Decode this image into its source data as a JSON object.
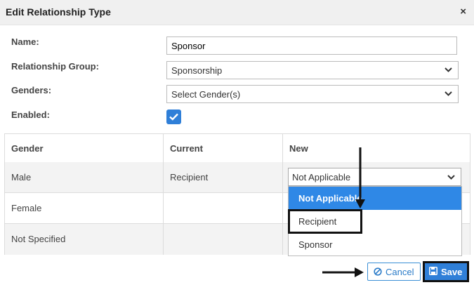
{
  "dialog": {
    "title": "Edit Relationship Type",
    "close_label": "×"
  },
  "form": {
    "name_label": "Name:",
    "name_value": "Sponsor",
    "group_label": "Relationship Group:",
    "group_value": "Sponsorship",
    "genders_label": "Genders:",
    "genders_placeholder": "Select Gender(s)",
    "enabled_label": "Enabled:",
    "enabled_checked": true
  },
  "table": {
    "headers": [
      "Gender",
      "Current",
      "New"
    ],
    "rows": [
      {
        "gender": "Male",
        "current": "Recipient",
        "new": "Not Applicable"
      },
      {
        "gender": "Female",
        "current": "",
        "new": ""
      },
      {
        "gender": "Not Specified",
        "current": "",
        "new": ""
      }
    ]
  },
  "dropdown": {
    "options": [
      "Not Applicable",
      "Recipient",
      "Sponsor"
    ],
    "selected": "Not Applicable"
  },
  "footer": {
    "cancel_label": "Cancel",
    "save_label": "Save"
  },
  "colors": {
    "accent": "#2f7fd8",
    "selected_option": "#2f88e6"
  }
}
